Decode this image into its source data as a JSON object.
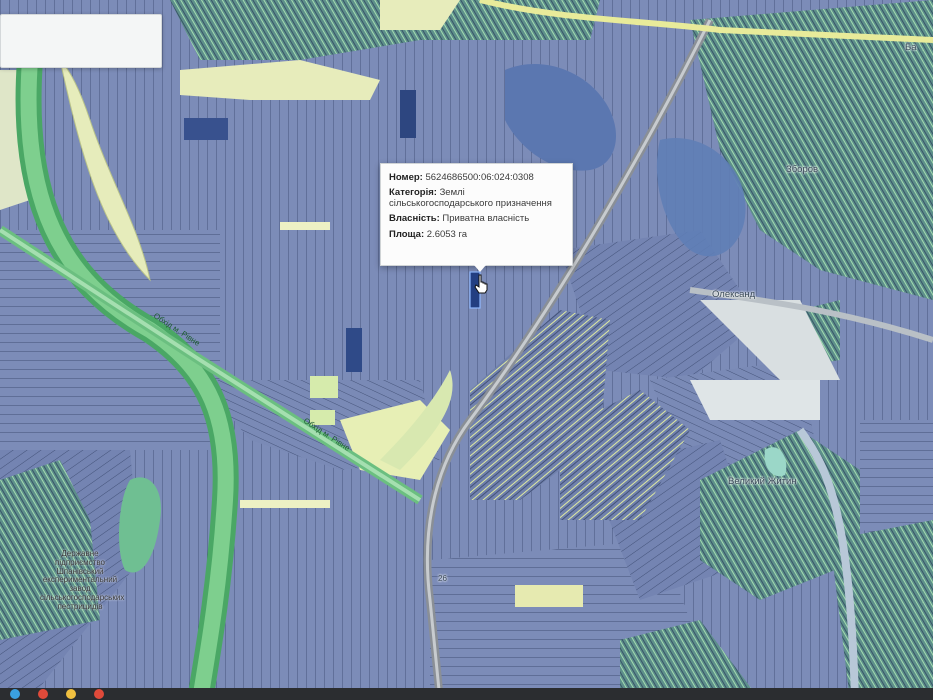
{
  "popup": {
    "number_label": "Номер:",
    "number_value": "5624686500:06:024:0308",
    "category_label": "Категорія:",
    "category_value": "Землі сільськогосподарського призначення",
    "ownership_label": "Власність:",
    "ownership_value": "Приватна власність",
    "area_label": "Площа:",
    "area_value": "2.6053 га"
  },
  "labels": {
    "zborov": "Зборов",
    "oleksandriya": "Олександ",
    "zhytyn": "Великий Житин",
    "top_right": "Ба",
    "road_left": "Обхід м. Рівне",
    "road_center": "Обхід м. Рівне",
    "area_text": "Державне підприємство Шпанівський експериментальний завод сільськогосподарських пестрицидів",
    "km": "26"
  },
  "colors": {
    "parcel": "#7a8bb8",
    "parcel_dark": "#36508e",
    "parcel_line": "#2e3c60",
    "forest": "#8fc88f",
    "road_green": "#5fb673",
    "field_yellow": "#e6edaa",
    "water": "#5a78b0"
  }
}
